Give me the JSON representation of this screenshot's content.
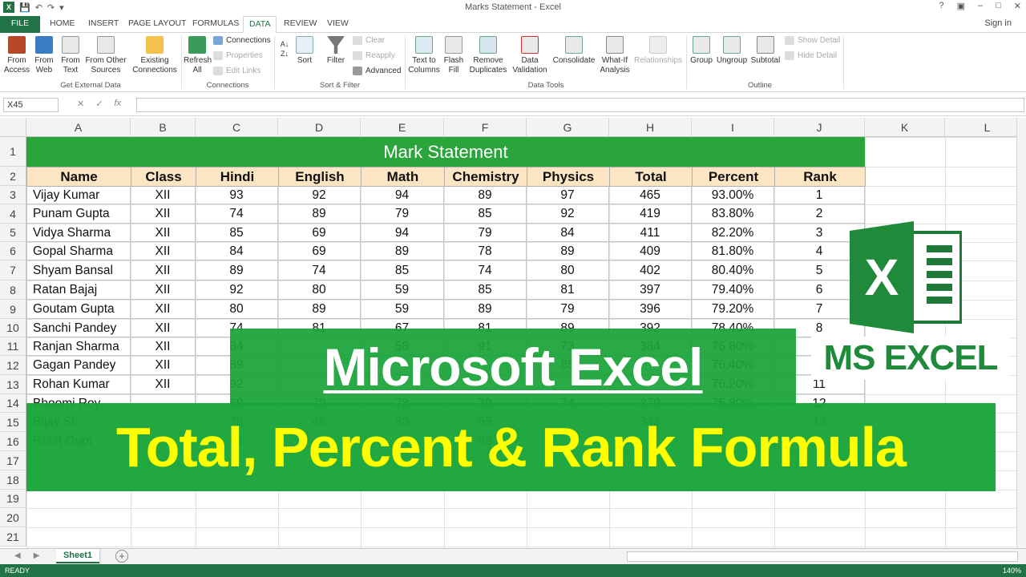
{
  "window": {
    "title": "Marks Statement - Excel",
    "app_icon_label": "X",
    "sign_in": "Sign in",
    "controls": [
      "?",
      "▣",
      "–",
      "□",
      "✕"
    ]
  },
  "tabs": [
    {
      "label": "FILE"
    },
    {
      "label": "HOME"
    },
    {
      "label": "INSERT"
    },
    {
      "label": "PAGE LAYOUT"
    },
    {
      "label": "FORMULAS"
    },
    {
      "label": "DATA"
    },
    {
      "label": "REVIEW"
    },
    {
      "label": "VIEW"
    }
  ],
  "ribbon": {
    "get_external": {
      "from_access": "From Access",
      "from_web": "From Web",
      "from_text": "From Text",
      "from_other": "From Other Sources",
      "existing": "Existing Connections",
      "group": "Get External Data"
    },
    "connections": {
      "refresh": "Refresh All",
      "connections": "Connections",
      "properties": "Properties",
      "edit_links": "Edit Links",
      "group": "Connections"
    },
    "sort_filter": {
      "sort": "Sort",
      "filter": "Filter",
      "clear": "Clear",
      "reapply": "Reapply",
      "advanced": "Advanced",
      "group": "Sort & Filter"
    },
    "data_tools": {
      "text_to_columns": "Text to Columns",
      "flash_fill": "Flash Fill",
      "remove_duplicates": "Remove Duplicates",
      "data_validation": "Data Validation",
      "consolidate": "Consolidate",
      "what_if": "What-If Analysis",
      "relationships": "Relationships",
      "group": "Data Tools"
    },
    "outline": {
      "group_btn": "Group",
      "ungroup": "Ungroup",
      "subtotal": "Subtotal",
      "show_detail": "Show Detail",
      "hide_detail": "Hide Detail",
      "group": "Outline"
    }
  },
  "formula_bar": {
    "name_box": "X45",
    "cancel": "✕",
    "enter": "✓",
    "fx": "fx",
    "value": ""
  },
  "columns": [
    "A",
    "B",
    "C",
    "D",
    "E",
    "F",
    "G",
    "H",
    "I",
    "J",
    "K",
    "L"
  ],
  "rows": [
    "1",
    "2",
    "3",
    "4",
    "5",
    "6",
    "7",
    "8",
    "9",
    "10",
    "11",
    "12",
    "13",
    "14",
    "15",
    "16",
    "17",
    "18",
    "19",
    "20",
    "21"
  ],
  "sheet": {
    "title": "Mark Statement",
    "headers": [
      "Name",
      "Class",
      "Hindi",
      "English",
      "Math",
      "Chemistry",
      "Physics",
      "Total",
      "Percent",
      "Rank"
    ],
    "records": [
      [
        "Vijay Kumar",
        "XII",
        "93",
        "92",
        "94",
        "89",
        "97",
        "465",
        "93.00%",
        "1"
      ],
      [
        "Punam Gupta",
        "XII",
        "74",
        "89",
        "79",
        "85",
        "92",
        "419",
        "83.80%",
        "2"
      ],
      [
        "Vidya Sharma",
        "XII",
        "85",
        "69",
        "94",
        "79",
        "84",
        "411",
        "82.20%",
        "3"
      ],
      [
        "Gopal Sharma",
        "XII",
        "84",
        "69",
        "89",
        "78",
        "89",
        "409",
        "81.80%",
        "4"
      ],
      [
        "Shyam Bansal",
        "XII",
        "89",
        "74",
        "85",
        "74",
        "80",
        "402",
        "80.40%",
        "5"
      ],
      [
        "Ratan Bajaj",
        "XII",
        "92",
        "80",
        "59",
        "85",
        "81",
        "397",
        "79.40%",
        "6"
      ],
      [
        "Goutam Gupta",
        "XII",
        "80",
        "89",
        "59",
        "89",
        "79",
        "396",
        "79.20%",
        "7"
      ],
      [
        "Sanchi Pandey",
        "XII",
        "74",
        "81",
        "67",
        "81",
        "89",
        "392",
        "78.40%",
        "8"
      ],
      [
        "Ranjan Sharma",
        "XII",
        "84",
        "",
        "58",
        "91",
        "73",
        "384",
        "76.80%",
        ""
      ],
      [
        "Gagan Pandey",
        "XII",
        "89",
        "",
        "",
        "",
        "85",
        "",
        "76.40%",
        ""
      ],
      [
        "Rohan Kumar",
        "XII",
        "92",
        "",
        "",
        "",
        "",
        "",
        "76.20%",
        "11"
      ],
      [
        "Bhoomi Roy",
        "",
        "69",
        "79",
        "78",
        "79",
        "74",
        "379",
        "75.80%",
        "12"
      ],
      [
        "Bijay Sh",
        "",
        "78",
        "46",
        "80",
        "65",
        "",
        "343",
        "",
        "13"
      ],
      [
        "Rohit Gupt",
        "",
        "81",
        "",
        "",
        "89",
        "",
        "",
        "",
        ""
      ]
    ]
  },
  "overlay": {
    "line1": "Microsoft Excel",
    "line2": "Total, Percent & Rank Formula",
    "badge": "MS EXCEL",
    "logo_letter": "X"
  },
  "sheet_tabs": {
    "active": "Sheet1",
    "add": "+"
  },
  "status": {
    "ready": "READY",
    "zoom": "140%"
  },
  "colors": {
    "excel_green": "#217346",
    "banner_green": "#2aa53b",
    "header_fill": "#fbe5c3",
    "overlay_text": "#ffff00"
  }
}
